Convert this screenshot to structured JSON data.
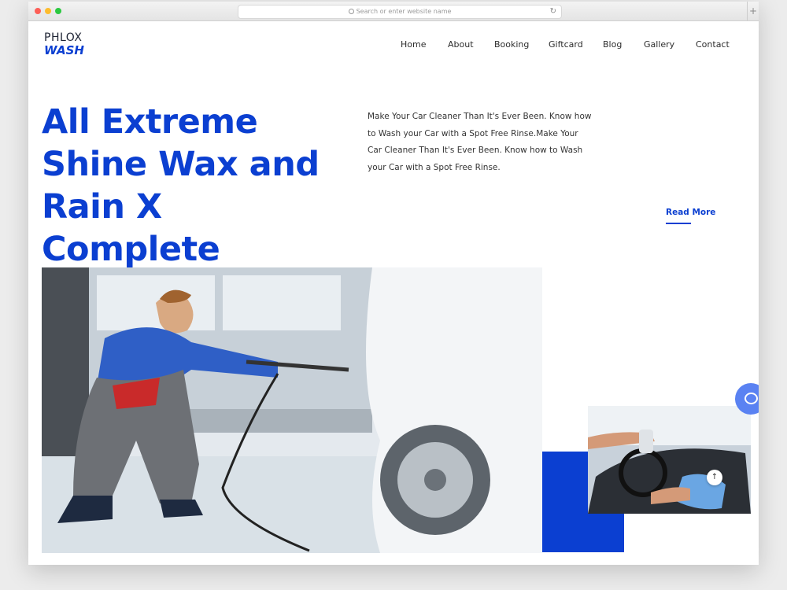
{
  "browser": {
    "url_placeholder": "Search or enter website name"
  },
  "logo": {
    "top": "PHLOX",
    "bottom": "WASH"
  },
  "nav": {
    "items": [
      "Home",
      "About",
      "Booking",
      "Giftcard",
      "Blog",
      "Gallery",
      "Contact"
    ]
  },
  "hero": {
    "title_lines": [
      "All Extreme",
      "Shine Wax and",
      "Rain X Complete"
    ],
    "description": "Make Your Car Cleaner Than It's Ever Been. Know how to Wash your Car with a Spot Free Rinse.Make Your Car Cleaner Than It's Ever Been. Know how to Wash your Car with a Spot Free Rinse.",
    "read_more": "Read More"
  },
  "colors": {
    "brand": "#0b3fd1",
    "chat": "#5a82f2"
  },
  "icons": {
    "chat": "chat-bubble-icon",
    "scroll_top": "arrow-up-icon",
    "reload": "reload-icon",
    "search": "search-icon"
  }
}
